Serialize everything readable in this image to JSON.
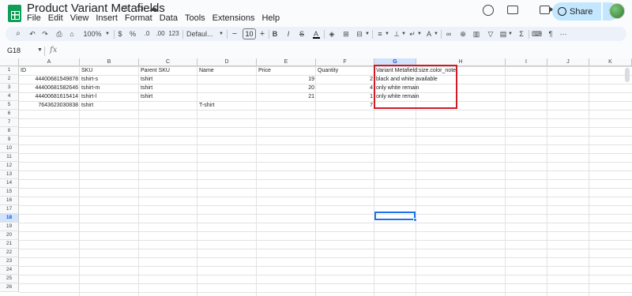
{
  "app": {
    "title": "Product Variant Metafields",
    "menu": [
      "File",
      "Edit",
      "View",
      "Insert",
      "Format",
      "Data",
      "Tools",
      "Extensions",
      "Help"
    ],
    "share_label": "Share"
  },
  "toolbar": {
    "zoom": "100%",
    "currency": "$",
    "percent": "%",
    "decrease_decimal": ".0",
    "increase_decimal": ".00",
    "number_format": "123",
    "font": "Defaul...",
    "font_size": "10",
    "bold": "B",
    "italic": "I",
    "strike": "S",
    "text_color": "A",
    "sum": "Σ"
  },
  "formula_bar": {
    "name_box": "G18",
    "fx": "fx"
  },
  "sheet": {
    "columns": [
      "A",
      "B",
      "C",
      "D",
      "E",
      "F",
      "G",
      "H",
      "I",
      "J",
      "K"
    ],
    "selected_column": "G",
    "rows": [
      "1",
      "2",
      "3",
      "4",
      "5",
      "6",
      "7",
      "8",
      "9",
      "10",
      "11",
      "12",
      "13",
      "14",
      "15",
      "16",
      "17",
      "18",
      "19",
      "20",
      "21",
      "22",
      "23",
      "24",
      "25",
      "26"
    ],
    "selected_row": "18",
    "header": [
      "ID",
      "SKU",
      "Parent SKU",
      "Name",
      "Price",
      "Quantity",
      "Variant Metafield:size.color_note"
    ],
    "data": [
      [
        "44400681549878",
        "tshirt-s",
        "tshirt",
        "",
        "19",
        "2",
        "black and white available"
      ],
      [
        "44400681582646",
        "tshirt-m",
        "tshirt",
        "",
        "20",
        "4",
        "only white remain"
      ],
      [
        "44400681615414",
        "tshirt-l",
        "tshirt",
        "",
        "21",
        "1",
        "only white remain"
      ],
      [
        "7643623030838",
        "tshirt",
        "",
        "T-shirt",
        "",
        "7",
        ""
      ]
    ]
  },
  "colors": {
    "accent": "#1a73e8",
    "highlight_border": "#d01b25",
    "share_bg": "#c2e7ff",
    "logo": "#0f9d58"
  }
}
